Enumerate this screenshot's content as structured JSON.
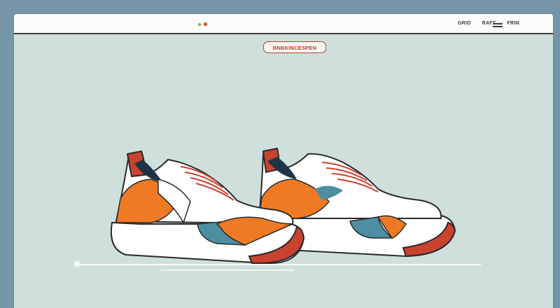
{
  "header": {
    "nav": [
      {
        "label": "GRID"
      },
      {
        "label": "RAFT"
      },
      {
        "label": "FRIN"
      }
    ],
    "menu_icon": "hamburger-icon",
    "logo_icon": "dot-logo-icon"
  },
  "hero": {
    "cta_label": "BNBKINCESPEN"
  },
  "colors": {
    "background": "#7596a8",
    "canvas": "#cfe0dc",
    "accent": "#b03d2e",
    "orange": "#f07a24",
    "teal": "#4e8ea3"
  }
}
